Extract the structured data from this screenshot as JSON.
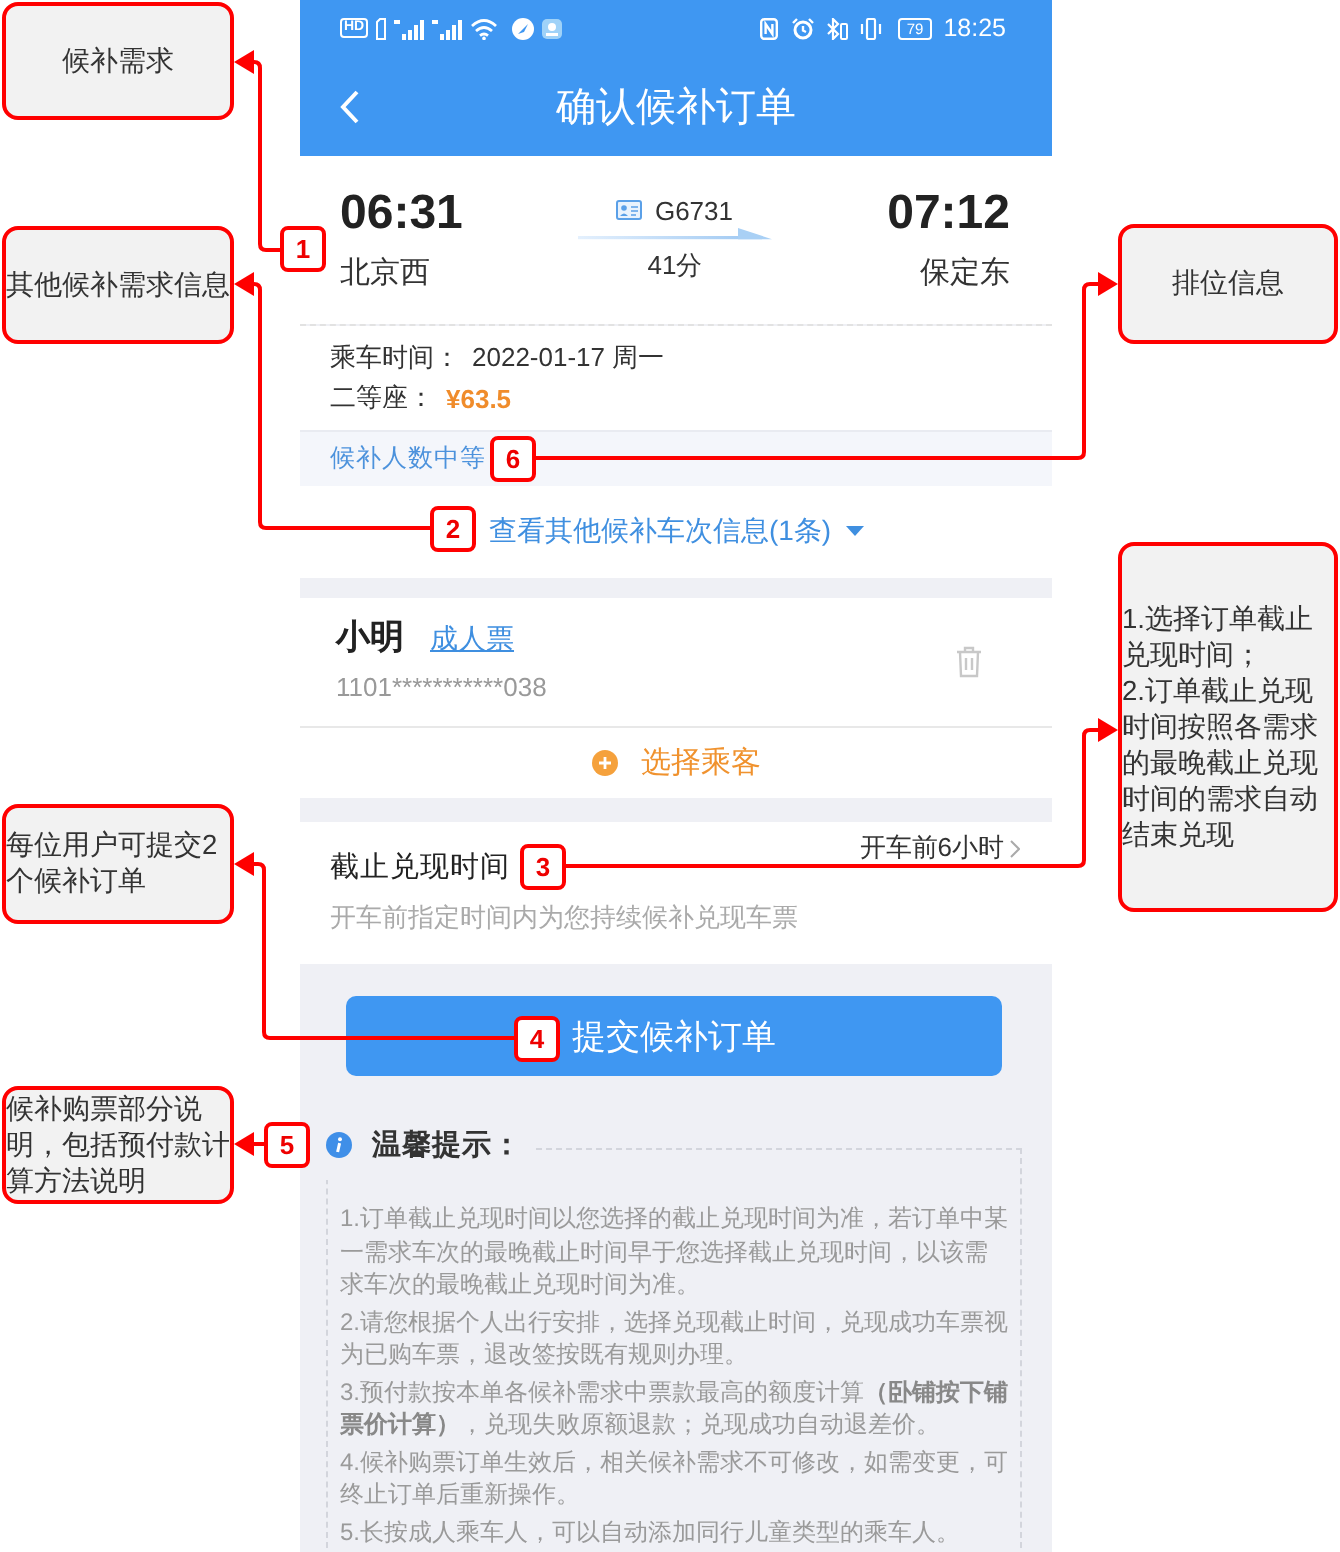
{
  "status_bar": {
    "badge": "HD",
    "battery": "79",
    "time": "18:25"
  },
  "nav": {
    "title": "确认候补订单"
  },
  "train": {
    "depart_time": "06:31",
    "depart_station": "北京西",
    "train_number": "G6731",
    "duration": "41分",
    "arrive_time": "07:12",
    "arrive_station": "保定东"
  },
  "details": [
    {
      "kind": "date",
      "label": "乘车时间：",
      "value": "2022-01-17 周一"
    },
    {
      "kind": "price",
      "label": "二等座：",
      "value": "¥63.5"
    }
  ],
  "queue_status": "候补人数中等",
  "other_trains_link": "查看其他候补车次信息(1条)",
  "passengers": [
    {
      "name": "小明",
      "ticket_type": "成人票",
      "id_number": "1101***********038"
    }
  ],
  "add_passenger": "选择乘客",
  "deadline": {
    "label": "截止兑现时间",
    "value": "开车前6小时",
    "hint": "开车前指定时间内为您持续候补兑现车票"
  },
  "submit_button": "提交候补订单",
  "tips": {
    "title": "温馨提示：",
    "items": [
      "1.订单截止兑现时间以您选择的截止兑现时间为准，若订单中某一需求车次的最晚截止时间早于您选择截止兑现时间，以该需求车次的最晚截止兑现时间为准。",
      "2.请您根据个人出行安排，选择兑现截止时间，兑现成功车票视为已购车票，退改签按既有规则办理。",
      "3.预付款按本单各候补需求中票款最高的额度计算**（卧铺按下铺票价计算）**，兑现失败原额退款；兑现成功自动退差价。",
      "4.候补购票订单生效后，相关候补需求不可修改，如需变更，可终止订单后重新操作。",
      "5.长按成人乘车人，可以自动添加同行儿童类型的乘车人。"
    ]
  },
  "annotations": [
    {
      "number": "1",
      "notes": [
        "候补需求"
      ]
    },
    {
      "number": "2",
      "notes": [
        "其他候补需求信息"
      ]
    },
    {
      "number": "3",
      "notes": [
        "1.选择订单截止兑现时间；",
        "2.订单截止兑现时间按照各需求的最晚截止兑现时间的需求自动结束兑现"
      ]
    },
    {
      "number": "4",
      "notes": [
        "每位用户可提交2个候补订单"
      ]
    },
    {
      "number": "5",
      "notes": [
        "候补购票部分说明，包括预付款计算方法说明"
      ]
    },
    {
      "number": "6",
      "notes": [
        "排位信息"
      ]
    }
  ]
}
